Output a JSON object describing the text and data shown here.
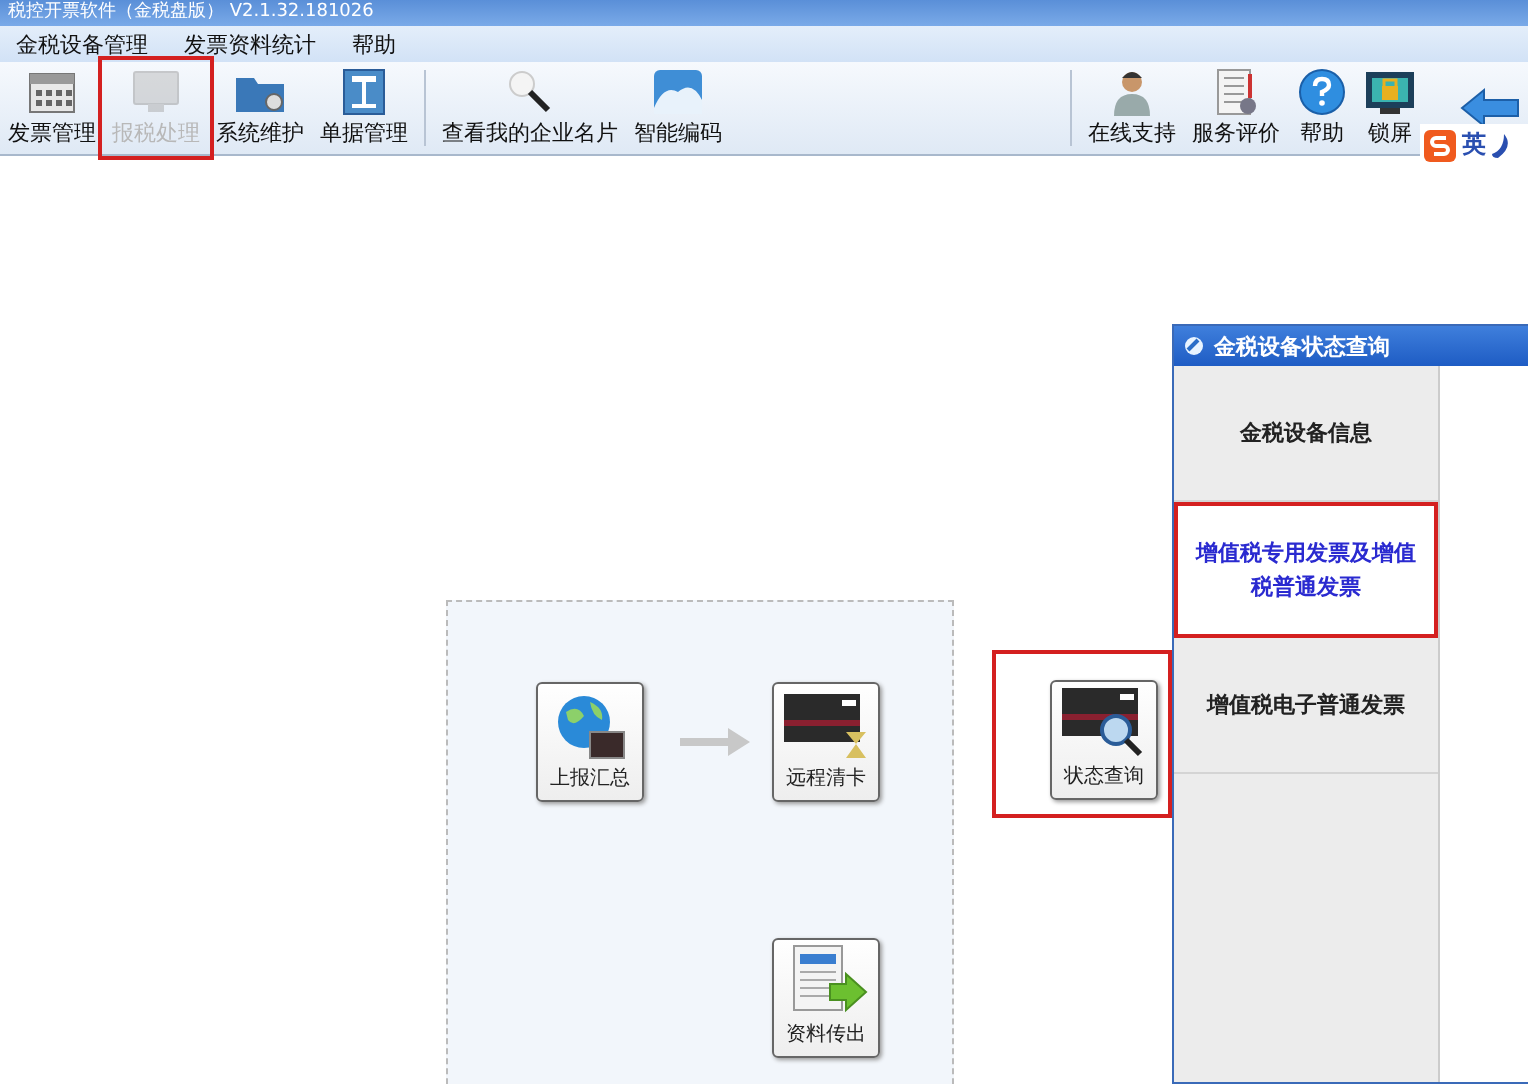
{
  "window": {
    "title": "税控开票软件（金税盘版） V2.1.32.181026"
  },
  "menu": [
    "金税设备管理",
    "发票资料统计",
    "帮助"
  ],
  "toolbar": {
    "left": [
      {
        "label": "发票管理",
        "disabled": false,
        "highlighted": false
      },
      {
        "label": "报税处理",
        "disabled": true,
        "highlighted": true
      },
      {
        "label": "系统维护",
        "disabled": false,
        "highlighted": false
      },
      {
        "label": "单据管理",
        "disabled": false,
        "highlighted": false
      }
    ],
    "middle": [
      {
        "label": "查看我的企业名片",
        "disabled": false,
        "highlighted": false
      },
      {
        "label": "智能编码",
        "disabled": false,
        "highlighted": false
      }
    ],
    "right": [
      {
        "label": "在线支持",
        "disabled": false,
        "highlighted": false
      },
      {
        "label": "服务评价",
        "disabled": false,
        "highlighted": false
      },
      {
        "label": "帮助",
        "disabled": false,
        "highlighted": false
      },
      {
        "label": "锁屏",
        "disabled": false,
        "highlighted": false
      }
    ]
  },
  "ime": {
    "label": "英"
  },
  "flow": [
    "上报汇总",
    "远程清卡",
    "资料传出"
  ],
  "status_button": {
    "label": "状态查询",
    "highlighted": true
  },
  "dialog": {
    "title": "金税设备状态查询",
    "tabs": [
      {
        "label": "金税设备信息",
        "selected": false,
        "highlighted": false
      },
      {
        "label": "增值税专用发票及增值税普通发票",
        "selected": true,
        "highlighted": true
      },
      {
        "label": "增值税电子普通发票",
        "selected": false,
        "highlighted": false
      }
    ]
  }
}
